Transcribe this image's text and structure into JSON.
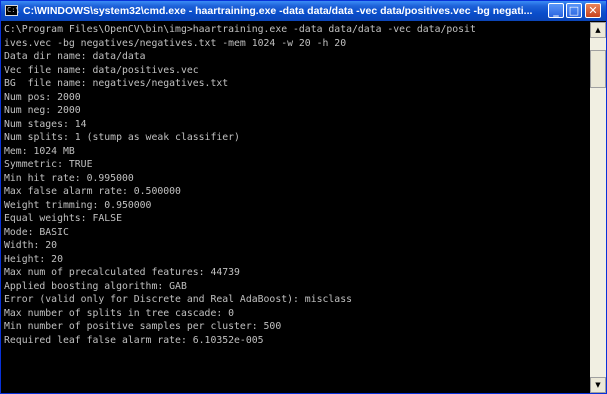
{
  "window": {
    "title": "C:\\WINDOWS\\system32\\cmd.exe - haartraining.exe -data data/data -vec data/positives.vec -bg negati...",
    "icon_text": "C:\\",
    "buttons": {
      "minimize": "_",
      "maximize": "□",
      "close": "✕"
    }
  },
  "scrollbar": {
    "up_arrow": "▲",
    "down_arrow": "▼"
  },
  "console": {
    "lines": [
      "C:\\Program Files\\OpenCV\\bin\\img>haartraining.exe -data data/data -vec data/posit",
      "ives.vec -bg negatives/negatives.txt -mem 1024 -w 20 -h 20",
      "Data dir name: data/data",
      "Vec file name: data/positives.vec",
      "BG  file name: negatives/negatives.txt",
      "Num pos: 2000",
      "Num neg: 2000",
      "Num stages: 14",
      "Num splits: 1 (stump as weak classifier)",
      "Mem: 1024 MB",
      "Symmetric: TRUE",
      "Min hit rate: 0.995000",
      "Max false alarm rate: 0.500000",
      "Weight trimming: 0.950000",
      "Equal weights: FALSE",
      "Mode: BASIC",
      "Width: 20",
      "Height: 20",
      "Max num of precalculated features: 44739",
      "Applied boosting algorithm: GAB",
      "Error (valid only for Discrete and Real AdaBoost): misclass",
      "Max number of splits in tree cascade: 0",
      "Min number of positive samples per cluster: 500",
      "Required leaf false alarm rate: 6.10352e-005"
    ]
  }
}
